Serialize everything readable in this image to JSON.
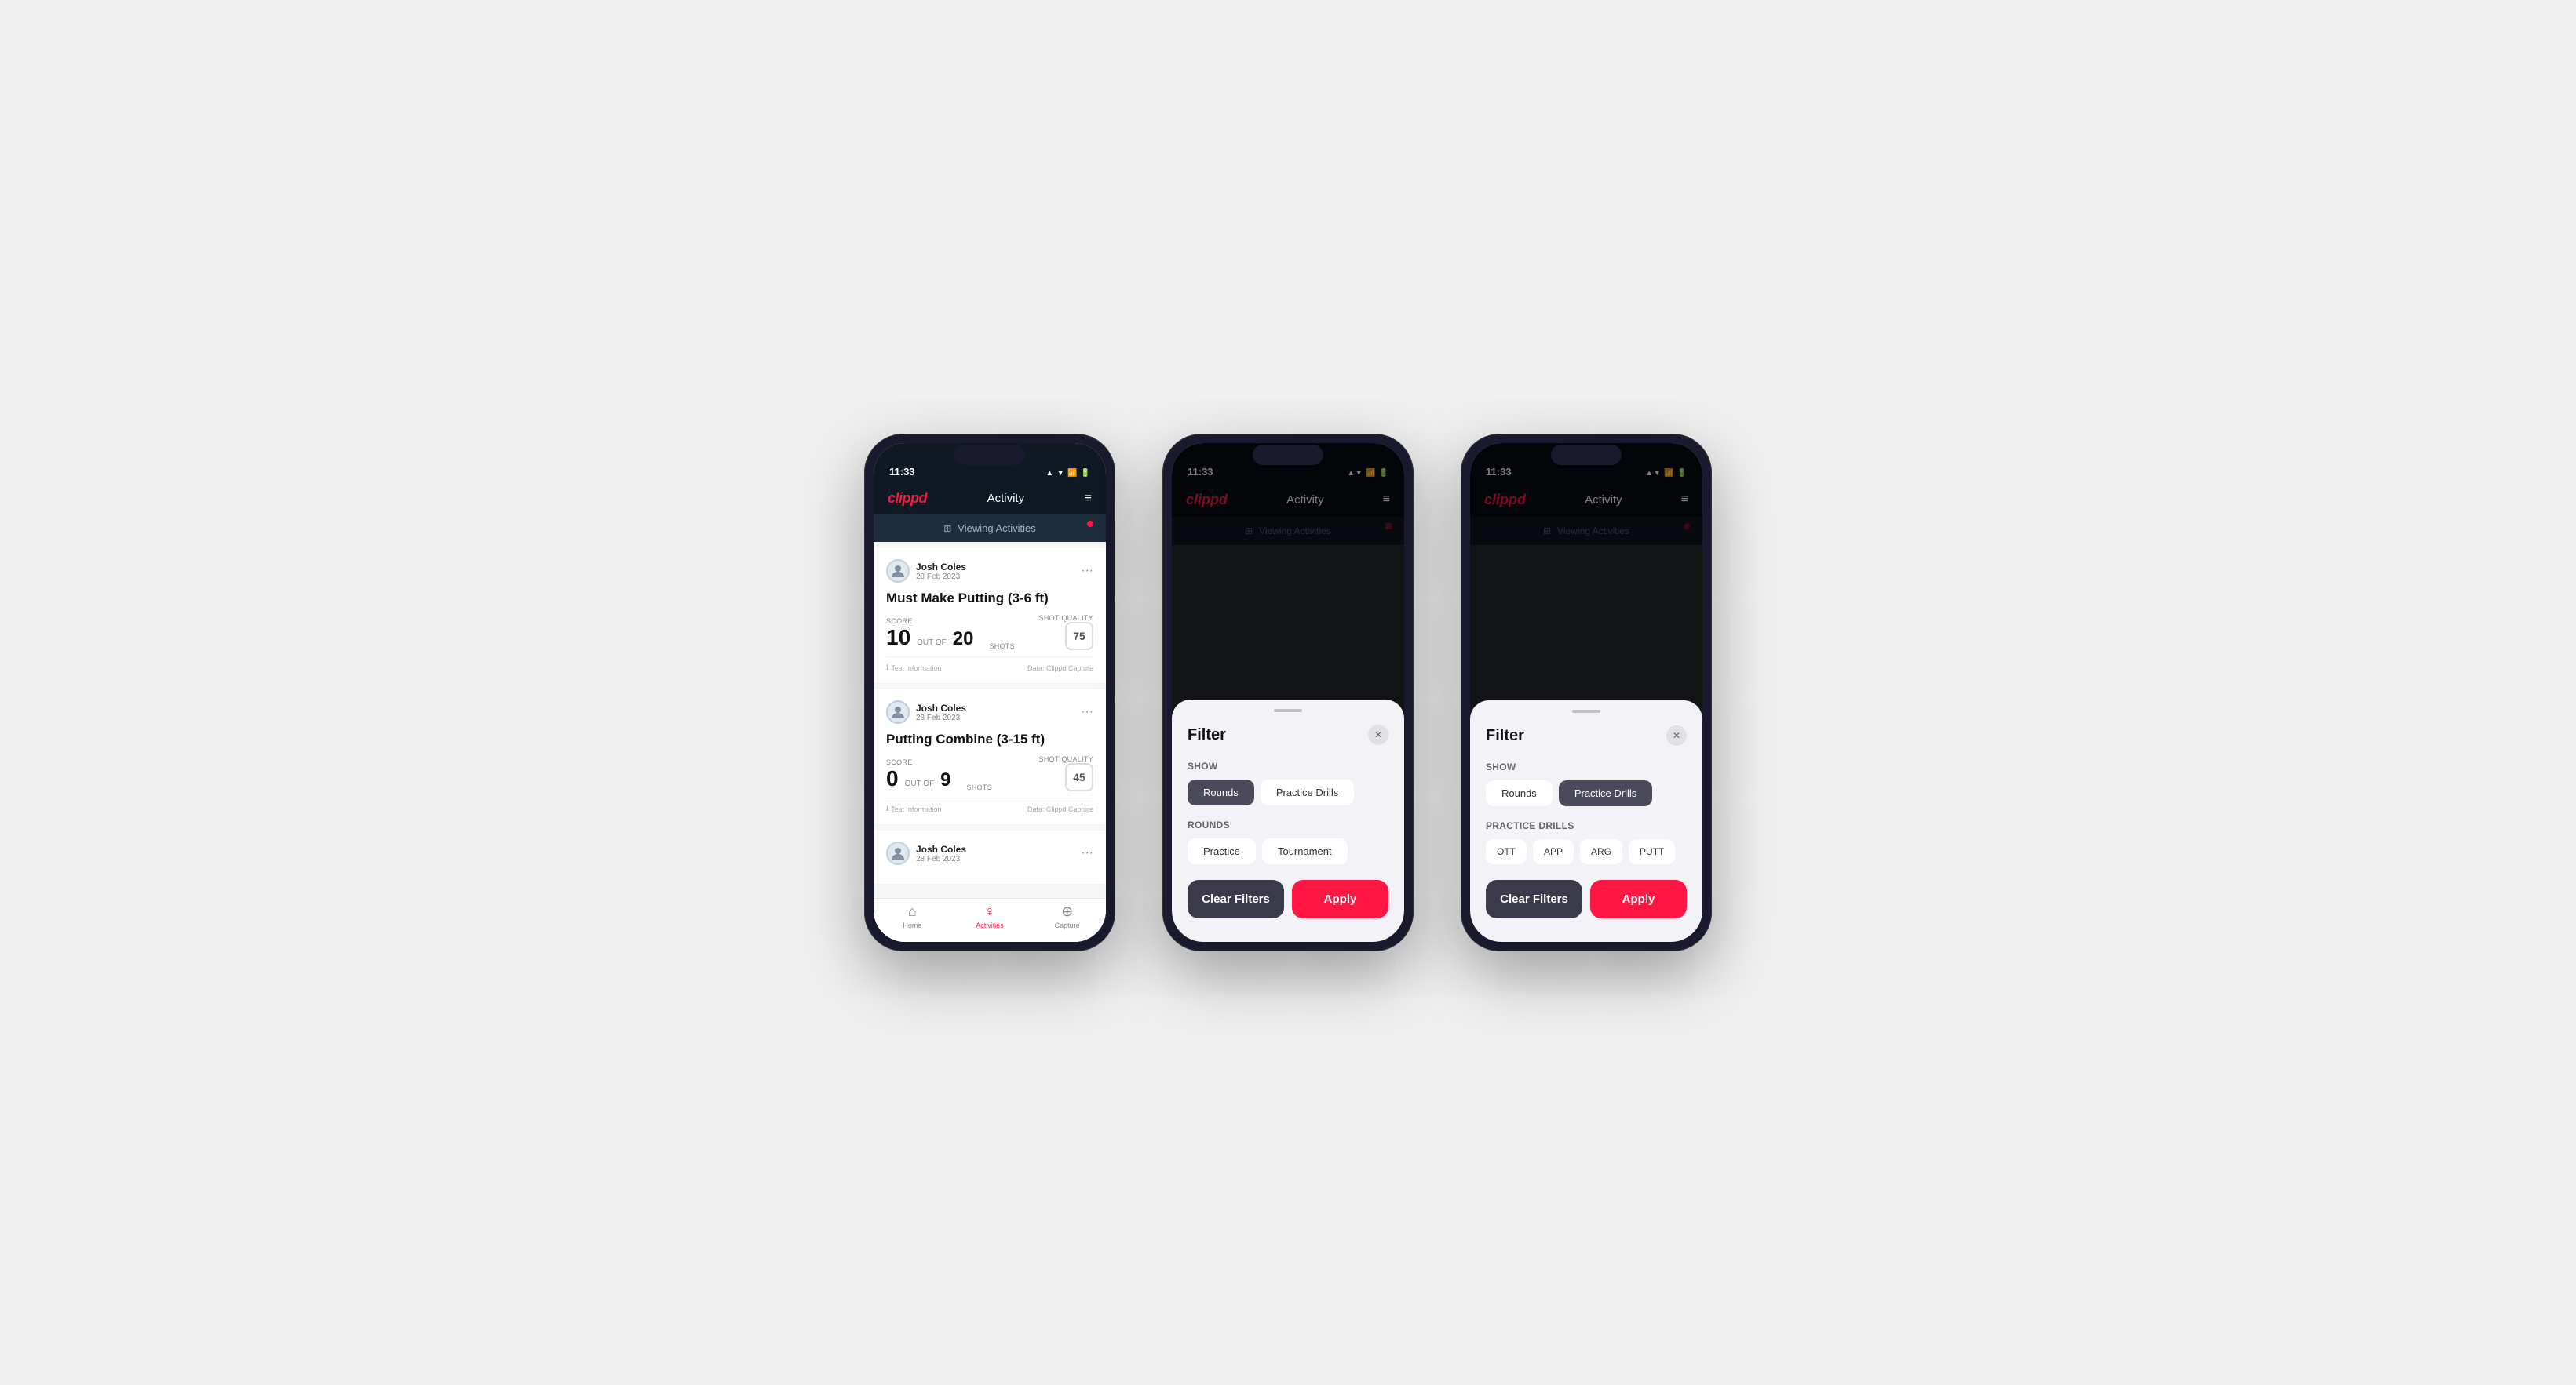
{
  "app": {
    "logo": "clippd",
    "header_title": "Activity",
    "time": "11:33",
    "status_icons": "▲ ▼ 📶",
    "menu_label": "≡",
    "viewing_activities_label": "Viewing Activities",
    "red_dot": true
  },
  "phone1": {
    "cards": [
      {
        "user_name": "Josh Coles",
        "user_date": "28 Feb 2023",
        "activity_title": "Must Make Putting (3-6 ft)",
        "score_label": "Score",
        "score_value": "10",
        "out_of_label": "OUT OF",
        "total_shots": "20",
        "shots_label": "Shots",
        "shot_quality_label": "Shot Quality",
        "shot_quality_value": "75",
        "info_label": "Test Information",
        "data_label": "Data: Clippd Capture"
      },
      {
        "user_name": "Josh Coles",
        "user_date": "28 Feb 2023",
        "activity_title": "Putting Combine (3-15 ft)",
        "score_label": "Score",
        "score_value": "0",
        "out_of_label": "OUT OF",
        "total_shots": "9",
        "shots_label": "Shots",
        "shot_quality_label": "Shot Quality",
        "shot_quality_value": "45",
        "info_label": "Test Information",
        "data_label": "Data: Clippd Capture"
      }
    ],
    "nav": [
      {
        "label": "Home",
        "icon": "⌂",
        "active": false
      },
      {
        "label": "Activities",
        "icon": "♀",
        "active": true
      },
      {
        "label": "Capture",
        "icon": "⊕",
        "active": false
      }
    ]
  },
  "phone2": {
    "filter_title": "Filter",
    "show_label": "Show",
    "rounds_label": "Rounds",
    "practice_drills_label": "Practice Drills",
    "rounds_section_label": "Rounds",
    "practice_btn": "Practice",
    "tournament_btn": "Tournament",
    "clear_filters_label": "Clear Filters",
    "apply_label": "Apply",
    "rounds_active": true,
    "practice_drills_active": false
  },
  "phone3": {
    "filter_title": "Filter",
    "show_label": "Show",
    "rounds_label": "Rounds",
    "practice_drills_label": "Practice Drills",
    "practice_drills_section_label": "Practice Drills",
    "ott_label": "OTT",
    "app_label": "APP",
    "arg_label": "ARG",
    "putt_label": "PUTT",
    "clear_filters_label": "Clear Filters",
    "apply_label": "Apply",
    "rounds_active": false,
    "practice_drills_active": true
  }
}
